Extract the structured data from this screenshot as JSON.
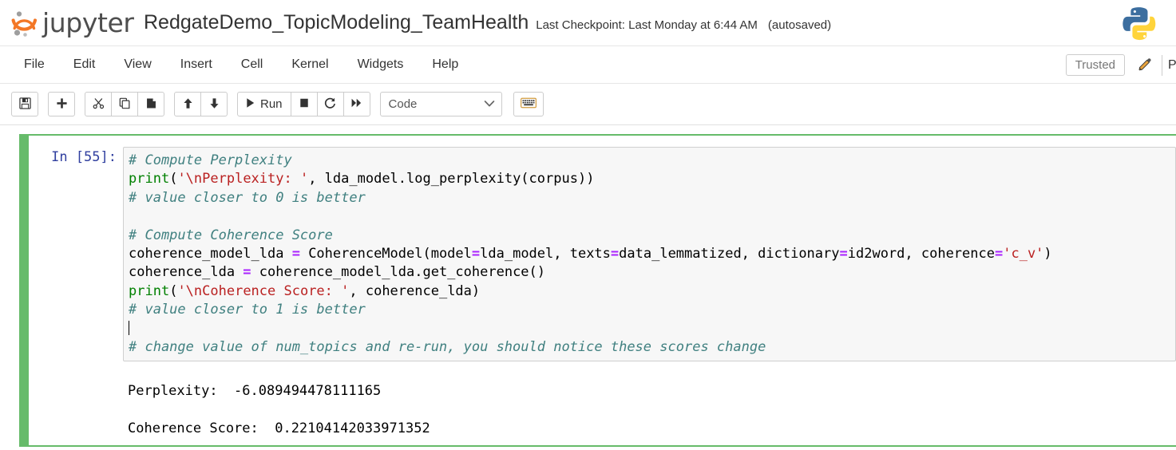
{
  "header": {
    "logo_word": "jupyter",
    "logo_icon": "jupyter-logo-icon",
    "notebook_name": "RedgateDemo_TopicModeling_TeamHealth",
    "checkpoint": "Last Checkpoint: Last Monday at 6:44 AM",
    "autosaved": "(autosaved)",
    "kernel_logo_icon": "python-logo-icon"
  },
  "menubar": {
    "items": [
      {
        "label": "File"
      },
      {
        "label": "Edit"
      },
      {
        "label": "View"
      },
      {
        "label": "Insert"
      },
      {
        "label": "Cell"
      },
      {
        "label": "Kernel"
      },
      {
        "label": "Widgets"
      },
      {
        "label": "Help"
      }
    ],
    "trusted_label": "Trusted",
    "edit_icon": "pencil-icon",
    "kernel_label": "P"
  },
  "toolbar": {
    "save_icon": "floppy-disk-icon",
    "insert_icon": "plus-icon",
    "cut_icon": "scissors-icon",
    "copy_icon": "copy-icon",
    "paste_icon": "paste-icon",
    "move_up_icon": "arrow-up-icon",
    "move_down_icon": "arrow-down-icon",
    "run_icon": "play-icon",
    "run_label": "Run",
    "stop_icon": "stop-square-icon",
    "restart_icon": "restart-circular-arrow-icon",
    "restart_run_all_icon": "fast-forward-icon",
    "celltype_value": "Code",
    "celltype_chevron_icon": "chevron-down-icon",
    "command_palette_icon": "keyboard-icon"
  },
  "cell": {
    "input_prompt": "In [55]:",
    "code_lines": [
      [
        {
          "t": "# Compute Perplexity",
          "c": "cm"
        }
      ],
      [
        {
          "t": "print",
          "c": "kw-print"
        },
        {
          "t": "(",
          "c": "plain"
        },
        {
          "t": "'\\nPerplexity: '",
          "c": "str"
        },
        {
          "t": ", lda_model.log_perplexity(corpus))",
          "c": "plain"
        }
      ],
      [
        {
          "t": "# value closer to 0 is better",
          "c": "cm"
        }
      ],
      [
        {
          "t": "",
          "c": "plain"
        }
      ],
      [
        {
          "t": "# Compute Coherence Score",
          "c": "cm"
        }
      ],
      [
        {
          "t": "coherence_model_lda ",
          "c": "plain"
        },
        {
          "t": "=",
          "c": "op"
        },
        {
          "t": " CoherenceModel(model",
          "c": "plain"
        },
        {
          "t": "=",
          "c": "op"
        },
        {
          "t": "lda_model, texts",
          "c": "plain"
        },
        {
          "t": "=",
          "c": "op"
        },
        {
          "t": "data_lemmatized, dictionary",
          "c": "plain"
        },
        {
          "t": "=",
          "c": "op"
        },
        {
          "t": "id2word, coherence",
          "c": "plain"
        },
        {
          "t": "=",
          "c": "op"
        },
        {
          "t": "'c_v'",
          "c": "str"
        },
        {
          "t": ")",
          "c": "plain"
        }
      ],
      [
        {
          "t": "coherence_lda ",
          "c": "plain"
        },
        {
          "t": "=",
          "c": "op"
        },
        {
          "t": " coherence_model_lda.get_coherence()",
          "c": "plain"
        }
      ],
      [
        {
          "t": "print",
          "c": "kw-print"
        },
        {
          "t": "(",
          "c": "plain"
        },
        {
          "t": "'\\nCoherence Score: '",
          "c": "str"
        },
        {
          "t": ", coherence_lda)",
          "c": "plain"
        }
      ],
      [
        {
          "t": "# value closer to 1 is better",
          "c": "cm"
        }
      ],
      [
        {
          "t": "",
          "c": "plain",
          "caret": true
        }
      ],
      [
        {
          "t": "# change value of num_topics and re-run, you should notice these scores change",
          "c": "cm"
        }
      ]
    ],
    "output_lines": [
      "Perplexity:  -6.089494478111165",
      "",
      "Coherence Score:  0.22104142033971352"
    ]
  },
  "colors": {
    "selected_cell_green": "#66bb6a",
    "jupyter_orange": "#f37726",
    "prompt_blue": "#303F9F",
    "comment_teal": "#408080",
    "string_red": "#BA2121",
    "builtin_green": "#008000",
    "operator_purple": "#AA22FF",
    "input_bg": "#f7f7f7"
  }
}
